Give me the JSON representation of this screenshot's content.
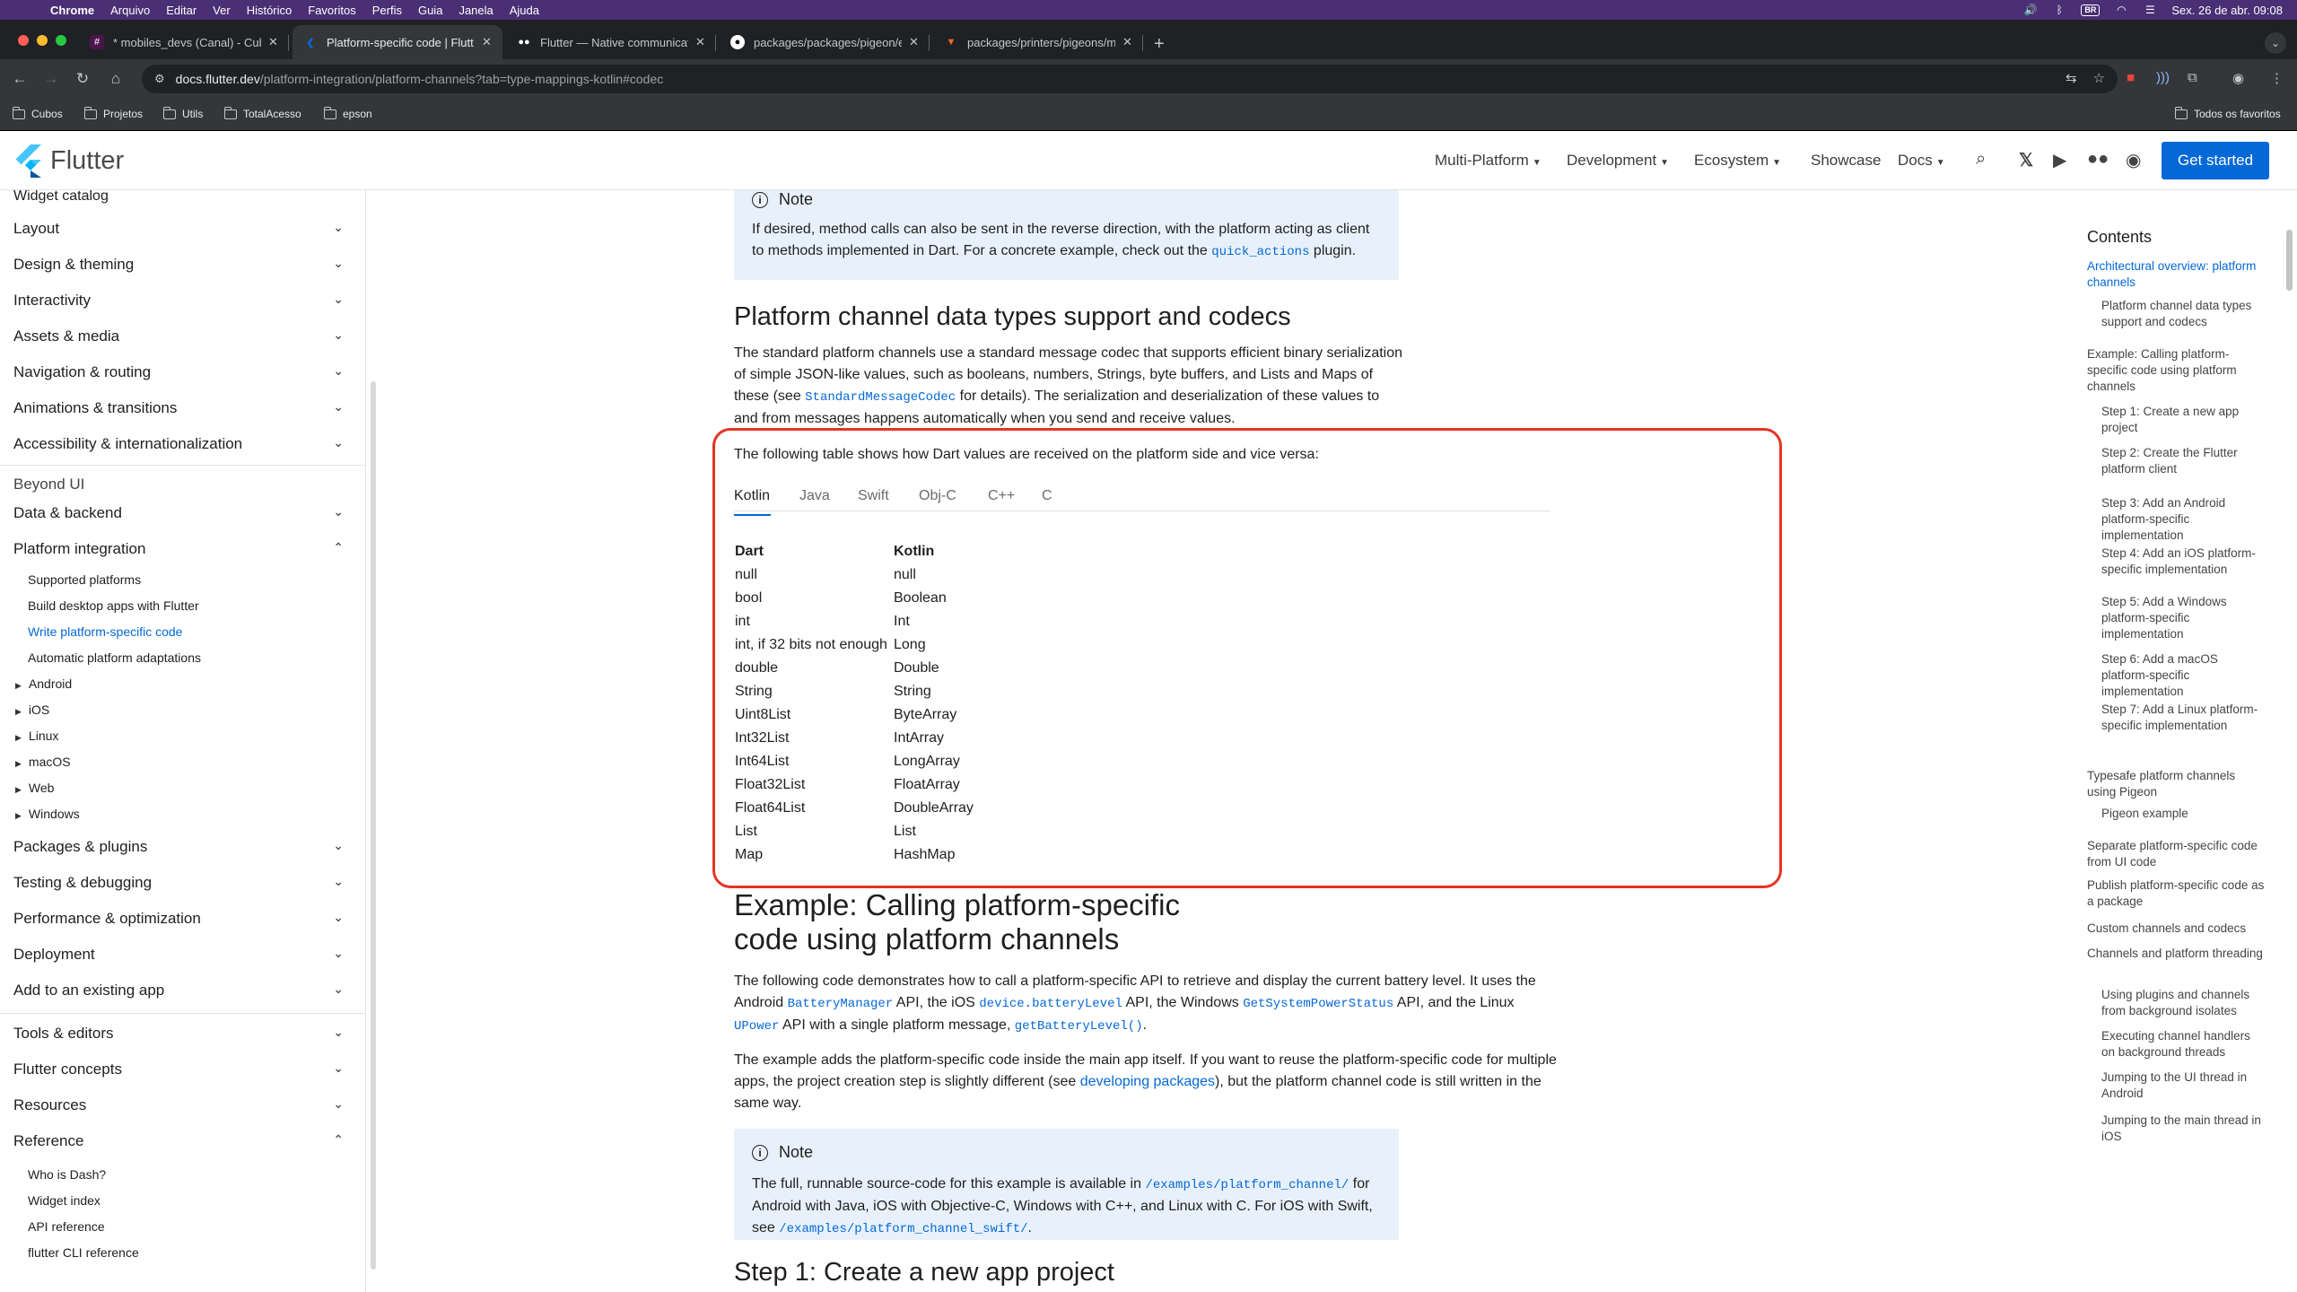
{
  "menubar": {
    "app": "Chrome",
    "items": [
      "Arquivo",
      "Editar",
      "Ver",
      "Histórico",
      "Favoritos",
      "Perfis",
      "Guia",
      "Janela",
      "Ajuda"
    ],
    "keyboard": "BR",
    "datetime": "Sex. 26 de abr.  09:08"
  },
  "tabs": [
    {
      "title": "* mobiles_devs (Canal) - Cub",
      "icon": "slack-icon",
      "color": "#4a154b"
    },
    {
      "title": "Platform-specific code | Flutt",
      "icon": "flutter-icon",
      "color": "#0468d7"
    },
    {
      "title": "Flutter — Native communicat",
      "icon": "medium-icon",
      "color": "#000000"
    },
    {
      "title": "packages/packages/pigeon/e",
      "icon": "github-icon",
      "color": "#ffffff"
    },
    {
      "title": "packages/printers/pigeons/m",
      "icon": "gitlab-icon",
      "color": "#fc6d26"
    }
  ],
  "omnibox": {
    "host": "docs.flutter.dev",
    "path": "/platform-integration/platform-channels?tab=type-mappings-kotlin#codec"
  },
  "bookmarks": [
    "Cubos",
    "Projetos",
    "Utils",
    "TotalAcesso",
    "epson"
  ],
  "bookmarks_all": "Todos os favoritos",
  "header": {
    "logo": "Flutter",
    "nav": [
      "Multi-Platform",
      "Development",
      "Ecosystem",
      "Showcase",
      "Docs"
    ],
    "cta": "Get started"
  },
  "sidebar": {
    "top": "Widget catalog",
    "groups1": [
      "Layout",
      "Design & theming",
      "Interactivity",
      "Assets & media",
      "Navigation & routing",
      "Animations & transitions",
      "Accessibility & internationalization"
    ],
    "section": "Beyond UI",
    "groups2a": [
      "Data & backend"
    ],
    "platform_integration": "Platform integration",
    "pi_links": [
      "Supported platforms",
      "Build desktop apps with Flutter",
      "Write platform-specific code",
      "Automatic platform adaptations"
    ],
    "pi_expand": [
      "Android",
      "iOS",
      "Linux",
      "macOS",
      "Web",
      "Windows"
    ],
    "groups2b": [
      "Packages & plugins",
      "Testing & debugging",
      "Performance & optimization",
      "Deployment",
      "Add to an existing app"
    ],
    "groups3": [
      "Tools & editors",
      "Flutter concepts",
      "Resources"
    ],
    "reference": "Reference",
    "ref_links": [
      "Who is Dash?",
      "Widget index",
      "API reference",
      "flutter CLI reference"
    ]
  },
  "content": {
    "note1": {
      "title": "Note",
      "text_before": "If desired, method calls can also be sent in the reverse direction, with the platform acting as client to methods implemented in Dart. For a concrete example, check out the ",
      "code": "quick_actions",
      "text_after": " plugin."
    },
    "h2_codecs": "Platform channel data types support and codecs",
    "codecs_p1_before": "The standard platform channels use a standard message codec that supports efficient binary serialization of simple JSON-like values, such as booleans, numbers, Strings, byte buffers, and Lists and Maps of these (see ",
    "codecs_p1_code": "StandardMessageCodec",
    "codecs_p1_after": " for details). The serialization and deserialization of these values to and from messages happens automatically when you send and receive values.",
    "table_intro": "The following table shows how Dart values are received on the platform side and vice versa:",
    "lang_tabs": [
      "Kotlin",
      "Java",
      "Swift",
      "Obj-C",
      "C++",
      "C"
    ],
    "table_header": [
      "Dart",
      "Kotlin"
    ],
    "table_rows": [
      [
        "null",
        "null"
      ],
      [
        "bool",
        "Boolean"
      ],
      [
        "int",
        "Int"
      ],
      [
        "int, if 32 bits not enough",
        "Long"
      ],
      [
        "double",
        "Double"
      ],
      [
        "String",
        "String"
      ],
      [
        "Uint8List",
        "ByteArray"
      ],
      [
        "Int32List",
        "IntArray"
      ],
      [
        "Int64List",
        "LongArray"
      ],
      [
        "Float32List",
        "FloatArray"
      ],
      [
        "Float64List",
        "DoubleArray"
      ],
      [
        "List",
        "List"
      ],
      [
        "Map",
        "HashMap"
      ]
    ],
    "h2_example_line1": "Example: Calling platform-specific",
    "h2_example_line2": "code using platform channels",
    "ex_p1": {
      "t1": "The following code demonstrates how to call a platform-specific API to retrieve and display the current battery level. It uses the Android ",
      "c1": "BatteryManager",
      "t2": " API, the iOS ",
      "c2": "device.batteryLevel",
      "t3": " API, the Windows ",
      "c3": "GetSystemPowerStatus",
      "t4": " API, and the Linux ",
      "c4": "UPower",
      "t5": " API with a single platform message, ",
      "c5": "getBatteryLevel()",
      "t6": "."
    },
    "ex_p2": {
      "t1": "The example adds the platform-specific code inside the main app itself. If you want to reuse the platform-specific code for multiple apps, the project creation step is slightly different (see ",
      "link": "developing packages",
      "t2": "), but the platform channel code is still written in the same way."
    },
    "note2": {
      "title": "Note",
      "t1": "The full, runnable source-code for this example is available in ",
      "c1": "/examples/platform_channel/",
      "t2": " for Android with Java, iOS with Objective-C, Windows with C++, and Linux with C. For iOS with Swift, see ",
      "c2": "/examples/platform_channel_swift/",
      "t3": "."
    },
    "h2_step1": "Step 1: Create a new app project"
  },
  "toc": {
    "title": "Contents",
    "items": [
      {
        "label": "Architectural overview: platform channels",
        "level": 1,
        "active": true
      },
      {
        "label": "Platform channel data types support and codecs",
        "level": 2
      },
      {
        "label": "Example: Calling platform-specific code using platform channels",
        "level": 1
      },
      {
        "label": "Step 1: Create a new app project",
        "level": 2
      },
      {
        "label": "Step 2: Create the Flutter platform client",
        "level": 2
      },
      {
        "label": "Step 3: Add an Android platform-specific implementation",
        "level": 2
      },
      {
        "label": "Step 4: Add an iOS platform-specific implementation",
        "level": 2
      },
      {
        "label": "Step 5: Add a Windows platform-specific implementation",
        "level": 2
      },
      {
        "label": "Step 6: Add a macOS platform-specific implementation",
        "level": 2
      },
      {
        "label": "Step 7: Add a Linux platform-specific implementation",
        "level": 2
      },
      {
        "label": "Typesafe platform channels using Pigeon",
        "level": 1
      },
      {
        "label": "Pigeon example",
        "level": 2
      },
      {
        "label": "Separate platform-specific code from UI code",
        "level": 1
      },
      {
        "label": "Publish platform-specific code as a package",
        "level": 1
      },
      {
        "label": "Custom channels and codecs",
        "level": 1
      },
      {
        "label": "Channels and platform threading",
        "level": 1
      },
      {
        "label": "Using plugins and channels from background isolates",
        "level": 2
      },
      {
        "label": "Executing channel handlers on background threads",
        "level": 2
      },
      {
        "label": "Jumping to the UI thread in Android",
        "level": 2
      },
      {
        "label": "Jumping to the main thread in iOS",
        "level": 2
      }
    ]
  }
}
